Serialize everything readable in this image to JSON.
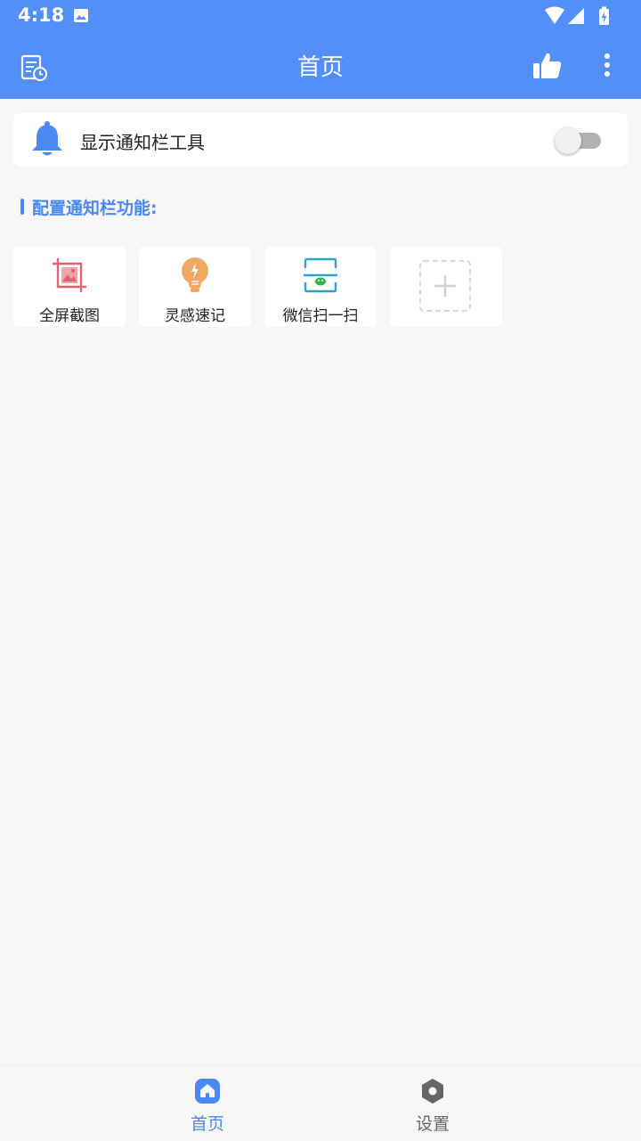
{
  "status_bar": {
    "time": "4:18",
    "icons": [
      "image-icon",
      "wifi-icon",
      "signal-icon",
      "battery-charging-icon"
    ]
  },
  "app_bar": {
    "title": "首页",
    "left_icon": "history-list-icon",
    "right_icons": [
      "thumbs-up-icon",
      "more-vertical-icon"
    ]
  },
  "notification_toggle": {
    "label": "显示通知栏工具",
    "icon": "bell-icon",
    "enabled": false
  },
  "section": {
    "title": "配置通知栏功能:"
  },
  "functions": [
    {
      "label": "全屏截图",
      "icon": "screenshot-crop-icon"
    },
    {
      "label": "灵感速记",
      "icon": "lightbulb-icon"
    },
    {
      "label": "微信扫一扫",
      "icon": "wechat-scan-icon"
    }
  ],
  "add_function": {
    "icon": "plus-icon"
  },
  "bottom_nav": {
    "home": {
      "label": "首页",
      "icon": "home-icon",
      "active": true
    },
    "settings": {
      "label": "设置",
      "icon": "settings-icon",
      "active": false
    }
  },
  "colors": {
    "primary": "#528ff8",
    "accent_text": "#4a88f3",
    "inactive": "#666666",
    "background": "#f7f7f7"
  }
}
